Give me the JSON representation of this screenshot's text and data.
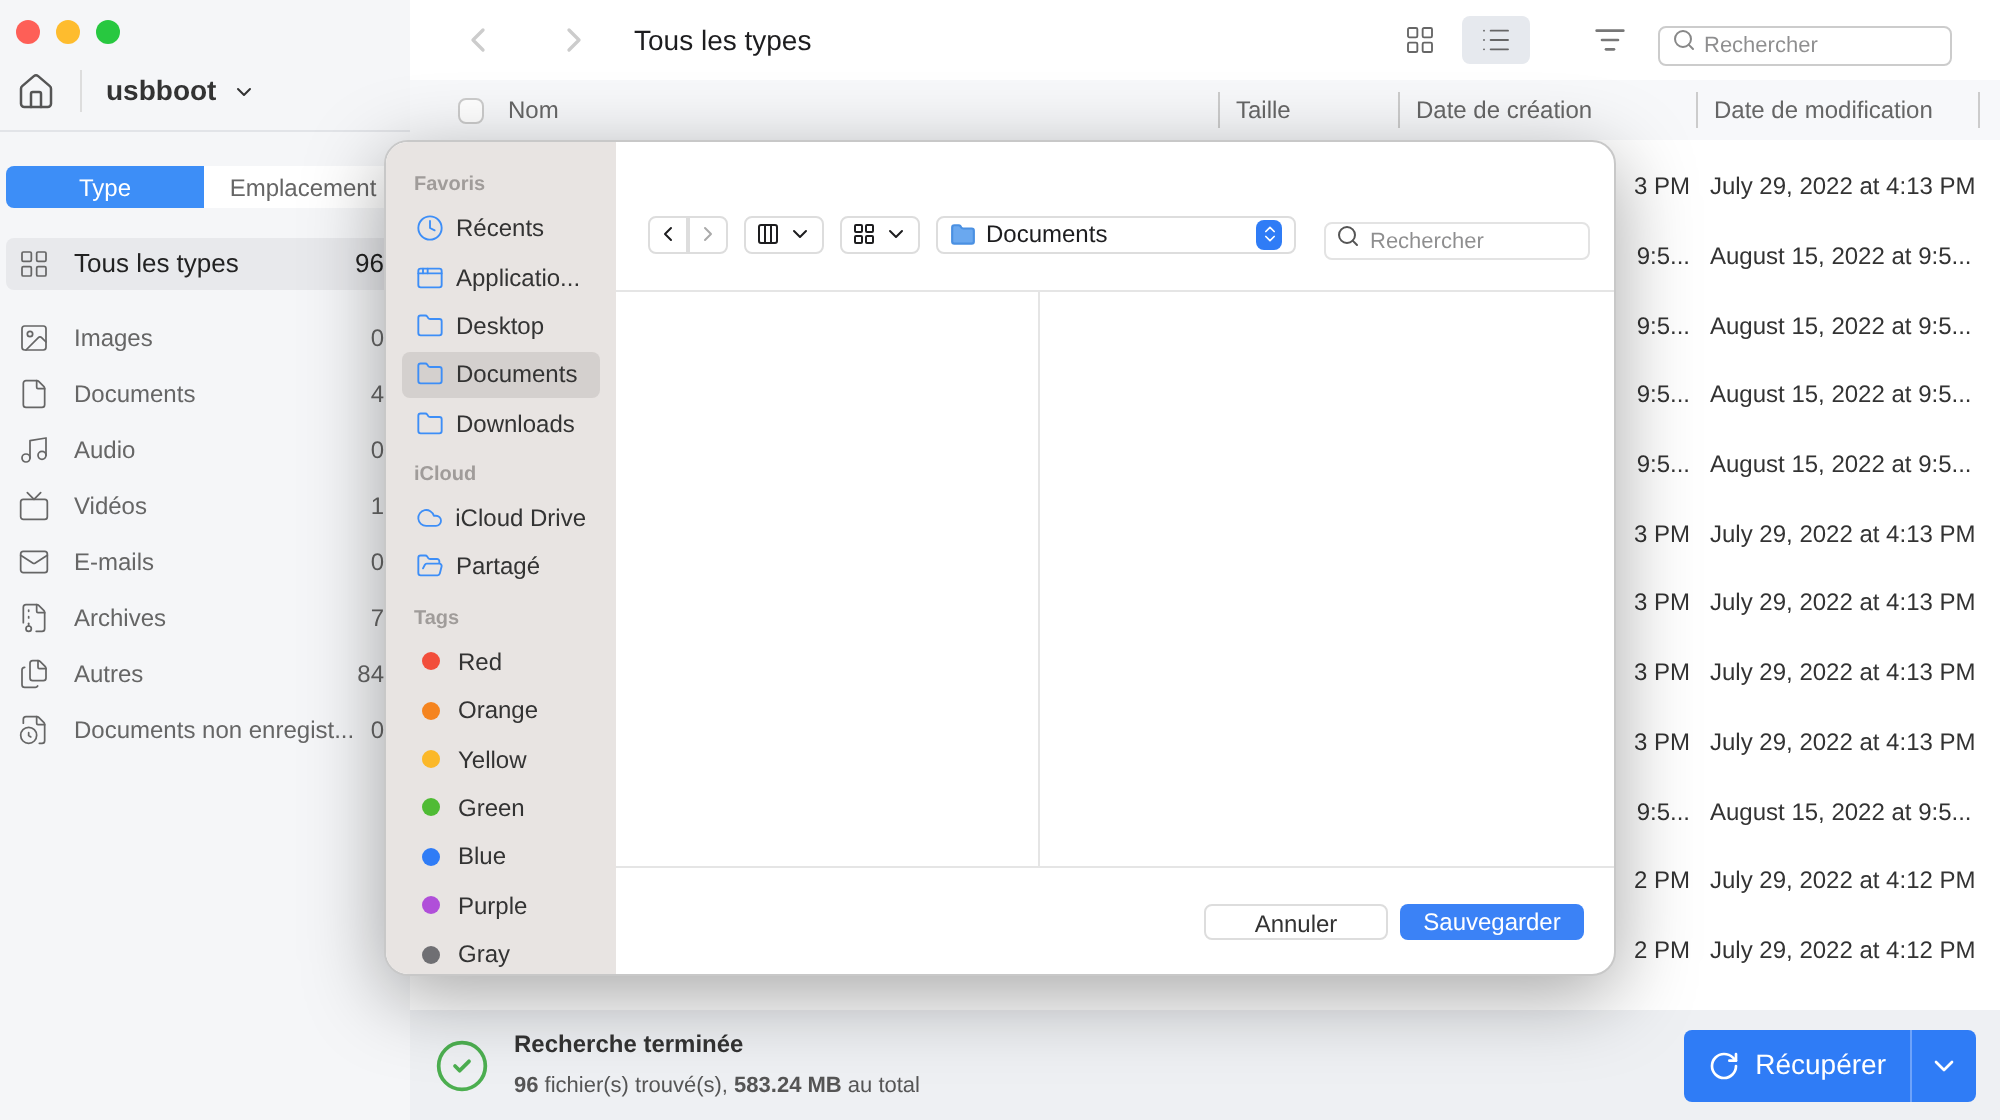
{
  "window": {
    "controls": [
      {
        "color": "#fe5f57"
      },
      {
        "color": "#febc2e"
      },
      {
        "color": "#28c840"
      }
    ]
  },
  "sidebar": {
    "drive": "usbboot",
    "tabs": [
      {
        "label": "Type",
        "selected": true
      },
      {
        "label": "Emplacement",
        "selected": false
      }
    ],
    "items": [
      {
        "kind": "all",
        "label": "Tous les types",
        "count": "96",
        "selected": true
      },
      {
        "kind": "image",
        "label": "Images",
        "count": "0",
        "selected": false
      },
      {
        "kind": "document",
        "label": "Documents",
        "count": "4",
        "selected": false
      },
      {
        "kind": "audio",
        "label": "Audio",
        "count": "0",
        "selected": false
      },
      {
        "kind": "video",
        "label": "Vidéos",
        "count": "1",
        "selected": false
      },
      {
        "kind": "email",
        "label": "E-mails",
        "count": "0",
        "selected": false
      },
      {
        "kind": "archive",
        "label": "Archives",
        "count": "7",
        "selected": false
      },
      {
        "kind": "other",
        "label": "Autres",
        "count": "84",
        "selected": false
      },
      {
        "kind": "unsaved",
        "label": "Documents non enregist...",
        "count": "0",
        "selected": false
      }
    ]
  },
  "toolbar": {
    "title": "Tous les types",
    "view": [
      {
        "kind": "grid",
        "selected": false
      },
      {
        "kind": "list",
        "selected": true
      }
    ],
    "search": {
      "placeholder": "Rechercher"
    }
  },
  "table": {
    "select_all": {
      "checked": false
    },
    "columns": [
      "Nom",
      "Taille",
      "Date de création",
      "Date de modification"
    ],
    "rows": [
      {
        "created": "3 PM",
        "modified": "July 29, 2022 at 4:13 PM"
      },
      {
        "created": "9:5...",
        "modified": "August 15, 2022 at 9:5..."
      },
      {
        "created": "9:5...",
        "modified": "August 15, 2022 at 9:5..."
      },
      {
        "created": "9:5...",
        "modified": "August 15, 2022 at 9:5..."
      },
      {
        "created": "9:5...",
        "modified": "August 15, 2022 at 9:5..."
      },
      {
        "created": "3 PM",
        "modified": "July 29, 2022 at 4:13 PM"
      },
      {
        "created": "3 PM",
        "modified": "July 29, 2022 at 4:13 PM"
      },
      {
        "created": "3 PM",
        "modified": "July 29, 2022 at 4:13 PM"
      },
      {
        "created": "3 PM",
        "modified": "July 29, 2022 at 4:13 PM"
      },
      {
        "created": "9:5...",
        "modified": "August 15, 2022 at 9:5..."
      },
      {
        "created": "2 PM",
        "modified": "July 29, 2022 at 4:12 PM"
      },
      {
        "created": "2 PM",
        "modified": "July 29, 2022 at 4:12 PM"
      }
    ]
  },
  "status": {
    "title": "Recherche terminée",
    "summary": "**96** fichier(s) trouvé(s), **583.24 MB** au total",
    "button": "Récupérer"
  },
  "dialog": {
    "sections": [
      {
        "title": "Favoris",
        "items": [
          {
            "kind": "clock",
            "label": "Récents",
            "selected": false
          },
          {
            "kind": "apps",
            "label": "Applicatio...",
            "selected": false
          },
          {
            "kind": "folder",
            "label": "Desktop",
            "selected": false
          },
          {
            "kind": "folder",
            "label": "Documents",
            "selected": true
          },
          {
            "kind": "folder",
            "label": "Downloads",
            "selected": false
          }
        ]
      },
      {
        "title": "iCloud",
        "items": [
          {
            "kind": "cloud",
            "label": "iCloud Drive",
            "selected": false
          },
          {
            "kind": "shared",
            "label": "Partagé",
            "selected": false
          }
        ]
      },
      {
        "title": "Tags",
        "items": [
          {
            "kind": "tag",
            "label": "Red",
            "color": "#f24e3b",
            "selected": false
          },
          {
            "kind": "tag",
            "label": "Orange",
            "color": "#f5841f",
            "selected": false
          },
          {
            "kind": "tag",
            "label": "Yellow",
            "color": "#fbb829",
            "selected": false
          },
          {
            "kind": "tag",
            "label": "Green",
            "color": "#4fbb34",
            "selected": false
          },
          {
            "kind": "tag",
            "label": "Blue",
            "color": "#2f7cf6",
            "selected": false
          },
          {
            "kind": "tag",
            "label": "Purple",
            "color": "#b04fd9",
            "selected": false
          },
          {
            "kind": "tag",
            "label": "Gray",
            "color": "#6f6f73",
            "selected": false
          }
        ]
      }
    ],
    "location": "Documents",
    "search": {
      "placeholder": "Rechercher"
    },
    "buttons": [
      {
        "kind": "secondary",
        "label": "Annuler"
      },
      {
        "kind": "primary",
        "label": "Sauvegarder"
      }
    ]
  }
}
